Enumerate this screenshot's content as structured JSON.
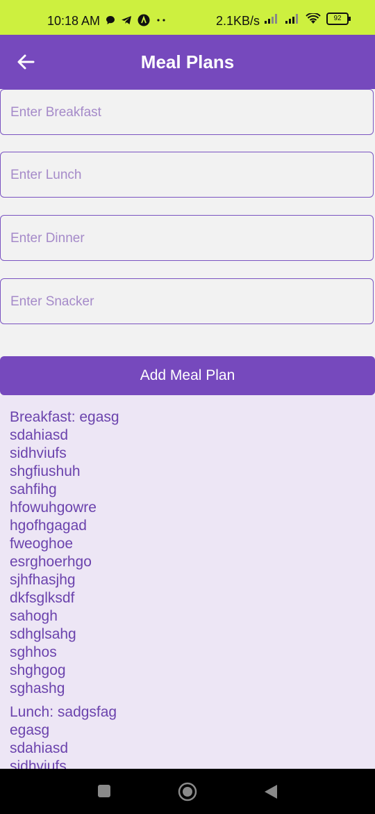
{
  "status_bar": {
    "time": "10:18 AM",
    "net_speed": "2.1KB/s",
    "battery": "92",
    "icons": [
      "chat-icon",
      "telegram-icon",
      "app-icon",
      "more-dots-icon",
      "signal-icon",
      "signal-icon",
      "wifi-icon",
      "battery-icon"
    ]
  },
  "header": {
    "title": "Meal Plans"
  },
  "form": {
    "breakfast_placeholder": "Enter Breakfast",
    "lunch_placeholder": "Enter Lunch",
    "dinner_placeholder": "Enter Dinner",
    "snacker_placeholder": "Enter Snacker",
    "add_button_label": "Add Meal Plan"
  },
  "plans": [
    {
      "lines": [
        "Breakfast: egasg",
        "sdahiasd",
        "sidhviufs",
        "shgfiushuh",
        "sahfihg",
        "hfowuhgowre",
        "hgofhgagad",
        "fweoghoe",
        "esrghoerhgo",
        "sjhfhasjhg",
        "dkfsglksdf",
        "sahogh",
        "sdhglsahg",
        "sghhos",
        "shghgog",
        "sghashg"
      ]
    },
    {
      "lines": [
        "Lunch: sadgsfag",
        "egasg",
        "sdahiasd",
        "sidhviufs"
      ]
    }
  ],
  "colors": {
    "status_bar": "#cdf03f",
    "primary": "#7649bd",
    "plans_background": "#ede6f5",
    "plan_text": "#6b43ad"
  }
}
